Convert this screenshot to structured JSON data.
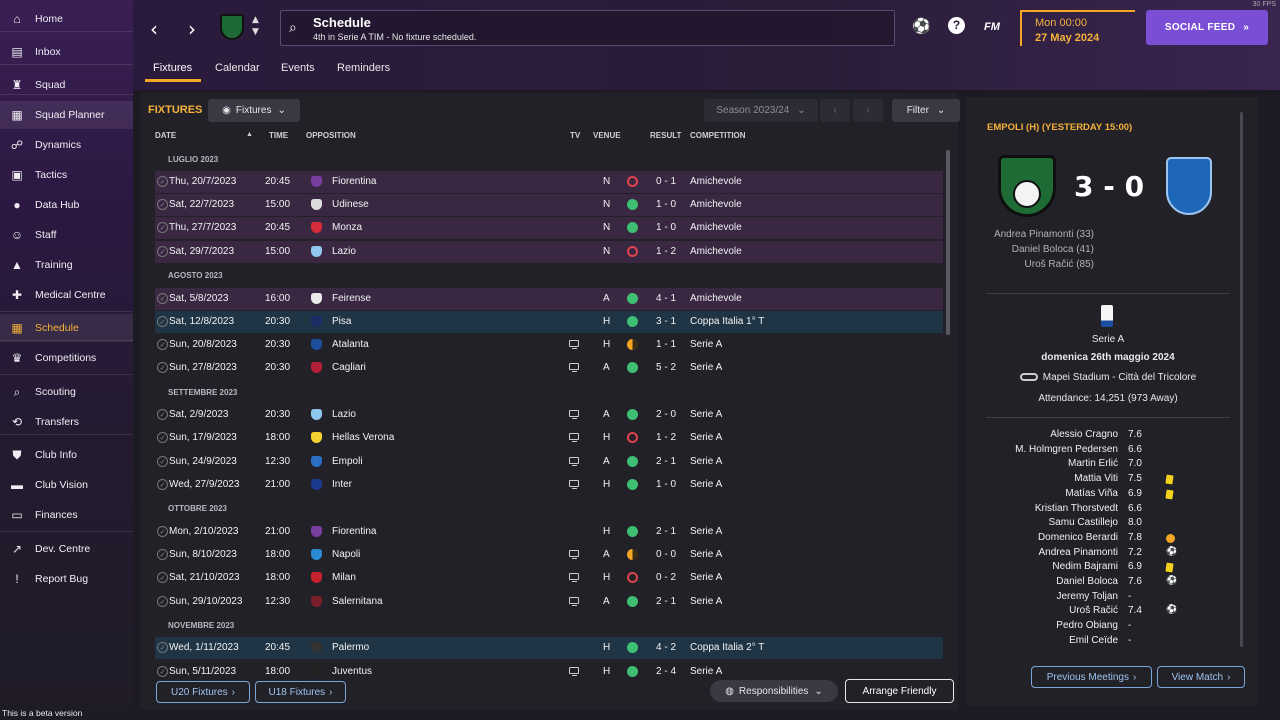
{
  "sidebar": {
    "items": [
      {
        "label": "Home",
        "icon": "home-icon"
      },
      {
        "label": "Inbox",
        "icon": "inbox-icon"
      },
      {
        "label": "Squad",
        "icon": "shirt-icon"
      },
      {
        "label": "Squad Planner",
        "icon": "clipboard-icon"
      },
      {
        "label": "Dynamics",
        "icon": "people-icon"
      },
      {
        "label": "Tactics",
        "icon": "tactics-icon"
      },
      {
        "label": "Data Hub",
        "icon": "data-icon"
      },
      {
        "label": "Staff",
        "icon": "staff-icon"
      },
      {
        "label": "Training",
        "icon": "training-icon"
      },
      {
        "label": "Medical Centre",
        "icon": "medical-icon"
      },
      {
        "label": "Schedule",
        "icon": "calendar-icon"
      },
      {
        "label": "Competitions",
        "icon": "trophy-icon"
      },
      {
        "label": "Scouting",
        "icon": "search-icon"
      },
      {
        "label": "Transfers",
        "icon": "transfer-icon"
      },
      {
        "label": "Club Info",
        "icon": "shield-icon"
      },
      {
        "label": "Club Vision",
        "icon": "briefcase-icon"
      },
      {
        "label": "Finances",
        "icon": "money-icon"
      },
      {
        "label": "Dev. Centre",
        "icon": "dev-icon"
      },
      {
        "label": "Report Bug",
        "icon": "bug-icon"
      }
    ],
    "beta": "This is a beta version"
  },
  "header": {
    "title": "Schedule",
    "subtitle": "4th in Serie A TIM - No fixture scheduled.",
    "fm": "FM",
    "time": "Mon 00:00",
    "date": "27 May 2024",
    "social": "SOCIAL FEED",
    "fps": "30 FPS"
  },
  "tabs": [
    "Fixtures",
    "Calendar",
    "Events",
    "Reminders"
  ],
  "fixtures": {
    "title": "FIXTURES",
    "view_dropdown": "Fixtures",
    "season": "Season 2023/24",
    "filter": "Filter",
    "columns": {
      "date": "DATE",
      "time": "TIME",
      "opposition": "OPPOSITION",
      "tv": "TV",
      "venue": "VENUE",
      "result": "RESULT",
      "competition": "COMPETITION"
    },
    "months": [
      "LUGLIO 2023",
      "AGOSTO 2023",
      "SETTEMBRE 2023",
      "OTTOBRE 2023",
      "NOVEMBRE 2023"
    ],
    "rows": [
      {
        "date": "Thu, 20/7/2023",
        "time": "20:45",
        "opp": "Fiorentina",
        "crest": "#7a3da0",
        "tv": false,
        "venue": "N",
        "res": "l",
        "score": "0 - 1",
        "comp": "Amichevole",
        "bg": "p"
      },
      {
        "date": "Sat, 22/7/2023",
        "time": "15:00",
        "opp": "Udinese",
        "crest": "#dddddd",
        "tv": false,
        "venue": "N",
        "res": "w",
        "score": "1 - 0",
        "comp": "Amichevole",
        "bg": "p"
      },
      {
        "date": "Thu, 27/7/2023",
        "time": "20:45",
        "opp": "Monza",
        "crest": "#d52b3a",
        "tv": false,
        "venue": "N",
        "res": "w",
        "score": "1 - 0",
        "comp": "Amichevole",
        "bg": "p"
      },
      {
        "date": "Sat, 29/7/2023",
        "time": "15:00",
        "opp": "Lazio",
        "crest": "#8fc7ee",
        "tv": false,
        "venue": "N",
        "res": "l",
        "score": "1 - 2",
        "comp": "Amichevole",
        "bg": "p"
      },
      {
        "date": "Sat, 5/8/2023",
        "time": "16:00",
        "opp": "Feirense",
        "crest": "#e9e9e9",
        "tv": false,
        "venue": "A",
        "res": "w",
        "score": "4 - 1",
        "comp": "Amichevole",
        "bg": "p"
      },
      {
        "date": "Sat, 12/8/2023",
        "time": "20:30",
        "opp": "Pisa",
        "crest": "#1b2d66",
        "tv": false,
        "venue": "H",
        "res": "w",
        "score": "3 - 1",
        "comp": "Coppa Italia 1° T",
        "bg": "b"
      },
      {
        "date": "Sun, 20/8/2023",
        "time": "20:30",
        "opp": "Atalanta",
        "crest": "#1c4e9c",
        "tv": true,
        "venue": "H",
        "res": "d",
        "score": "1 - 1",
        "comp": "Serie A",
        "bg": ""
      },
      {
        "date": "Sun, 27/8/2023",
        "time": "20:30",
        "opp": "Cagliari",
        "crest": "#b31f36",
        "tv": true,
        "venue": "A",
        "res": "w",
        "score": "5 - 2",
        "comp": "Serie A",
        "bg": ""
      },
      {
        "date": "Sat, 2/9/2023",
        "time": "20:30",
        "opp": "Lazio",
        "crest": "#8fc7ee",
        "tv": true,
        "venue": "A",
        "res": "w",
        "score": "2 - 0",
        "comp": "Serie A",
        "bg": ""
      },
      {
        "date": "Sun, 17/9/2023",
        "time": "18:00",
        "opp": "Hellas Verona",
        "crest": "#f2d230",
        "tv": true,
        "venue": "H",
        "res": "l",
        "score": "1 - 2",
        "comp": "Serie A",
        "bg": ""
      },
      {
        "date": "Sun, 24/9/2023",
        "time": "12:30",
        "opp": "Empoli",
        "crest": "#2a6fc4",
        "tv": true,
        "venue": "A",
        "res": "w",
        "score": "2 - 1",
        "comp": "Serie A",
        "bg": ""
      },
      {
        "date": "Wed, 27/9/2023",
        "time": "21:00",
        "opp": "Inter",
        "crest": "#1a3a8c",
        "tv": true,
        "venue": "H",
        "res": "w",
        "score": "1 - 0",
        "comp": "Serie A",
        "bg": ""
      },
      {
        "date": "Mon, 2/10/2023",
        "time": "21:00",
        "opp": "Fiorentina",
        "crest": "#7a3da0",
        "tv": false,
        "venue": "H",
        "res": "w",
        "score": "2 - 1",
        "comp": "Serie A",
        "bg": ""
      },
      {
        "date": "Sun, 8/10/2023",
        "time": "18:00",
        "opp": "Napoli",
        "crest": "#2a8bd4",
        "tv": true,
        "venue": "A",
        "res": "d",
        "score": "0 - 0",
        "comp": "Serie A",
        "bg": ""
      },
      {
        "date": "Sat, 21/10/2023",
        "time": "18:00",
        "opp": "Milan",
        "crest": "#c6232f",
        "tv": true,
        "venue": "H",
        "res": "l",
        "score": "0 - 2",
        "comp": "Serie A",
        "bg": ""
      },
      {
        "date": "Sun, 29/10/2023",
        "time": "12:30",
        "opp": "Salernitana",
        "crest": "#7a1e2a",
        "tv": true,
        "venue": "A",
        "res": "w",
        "score": "2 - 1",
        "comp": "Serie A",
        "bg": ""
      },
      {
        "date": "Wed, 1/11/2023",
        "time": "20:45",
        "opp": "Palermo",
        "crest": "#333333",
        "tv": false,
        "venue": "H",
        "res": "w",
        "score": "4 - 2",
        "comp": "Coppa Italia 2° T",
        "bg": "b"
      },
      {
        "date": "Sun, 5/11/2023",
        "time": "18:00",
        "opp": "Juventus",
        "crest": "#222222",
        "tv": true,
        "venue": "H",
        "res": "w",
        "score": "2 - 4",
        "comp": "Serie A",
        "bg": ""
      }
    ],
    "u20": "U20 Fixtures",
    "u18": "U18 Fixtures",
    "responsibilities": "Responsibilities",
    "arrange_friendly": "Arrange Friendly"
  },
  "match": {
    "title": "EMPOLI (H) (YESTERDAY 15:00)",
    "score": "3 - 0",
    "scorers": [
      "Andrea Pinamonti (33)",
      "Daniel Boloca (41)",
      "Uroš Račić (85)"
    ],
    "competition": "Serie A",
    "date": "domenica 26th maggio 2024",
    "stadium": "Mapei Stadium - Città del Tricolore",
    "attendance": "Attendance: 14,251 (973 Away)",
    "players": [
      {
        "name": "Alessio Cragno",
        "rating": "7.6",
        "event": ""
      },
      {
        "name": "M. Holmgren Pedersen",
        "rating": "6.6",
        "event": ""
      },
      {
        "name": "Martin Erlić",
        "rating": "7.0",
        "event": ""
      },
      {
        "name": "Mattia Viti",
        "rating": "7.5",
        "event": "yc"
      },
      {
        "name": "Matías Viña",
        "rating": "6.9",
        "event": "yc"
      },
      {
        "name": "Kristian Thorstvedt",
        "rating": "6.6",
        "event": ""
      },
      {
        "name": "Samu Castillejo",
        "rating": "8.0",
        "event": ""
      },
      {
        "name": "Domenico Berardi",
        "rating": "7.8",
        "event": "assist"
      },
      {
        "name": "Andrea Pinamonti",
        "rating": "7.2",
        "event": "ball"
      },
      {
        "name": "Nedim Bajrami",
        "rating": "6.9",
        "event": "yc"
      },
      {
        "name": "Daniel Boloca",
        "rating": "7.6",
        "event": "ball"
      },
      {
        "name": "Jeremy Toljan",
        "rating": "-",
        "event": ""
      },
      {
        "name": "Uroš Račić",
        "rating": "7.4",
        "event": "ball"
      },
      {
        "name": "Pedro Obiang",
        "rating": "-",
        "event": ""
      },
      {
        "name": "Emil Ceïde",
        "rating": "-",
        "event": ""
      }
    ],
    "prev_meetings": "Previous Meetings",
    "view_match": "View Match"
  },
  "colors": {
    "accent": "#f5a623",
    "social": "#7a4fd6",
    "win": "#3ebf73",
    "loss": "#e0434d",
    "draw": "#f5a623"
  }
}
